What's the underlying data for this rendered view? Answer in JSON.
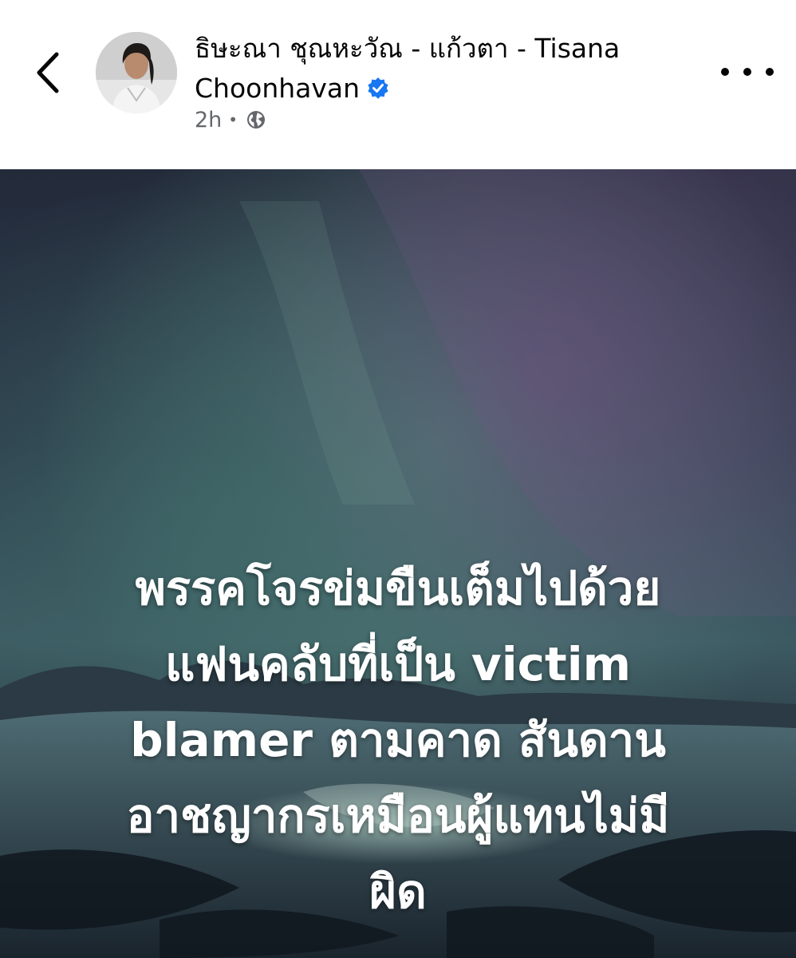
{
  "header": {
    "back_icon": "chevron-left-icon",
    "author_line1": "ธิษะณา ชุณหะวัณ - แก้วตา - Tisana",
    "author_line2": "Choonhavan",
    "verified_icon": "verified-badge-icon",
    "timestamp": "2h",
    "separator": "•",
    "audience_icon": "globe-icon",
    "more_icon": "more-options-icon"
  },
  "post": {
    "text_lines": [
      "พรรคโจรข่มขืนเต็มไปด้วย",
      "แฟนคลับที่เป็น victim",
      "blamer ตามคาด สันดาน",
      "อาชญากรเหมือนผู้แทนไม่มี",
      "ผิด"
    ]
  },
  "colors": {
    "verified_blue": "#1877f2",
    "meta_gray": "#65676b",
    "text_white": "#ffffff"
  }
}
